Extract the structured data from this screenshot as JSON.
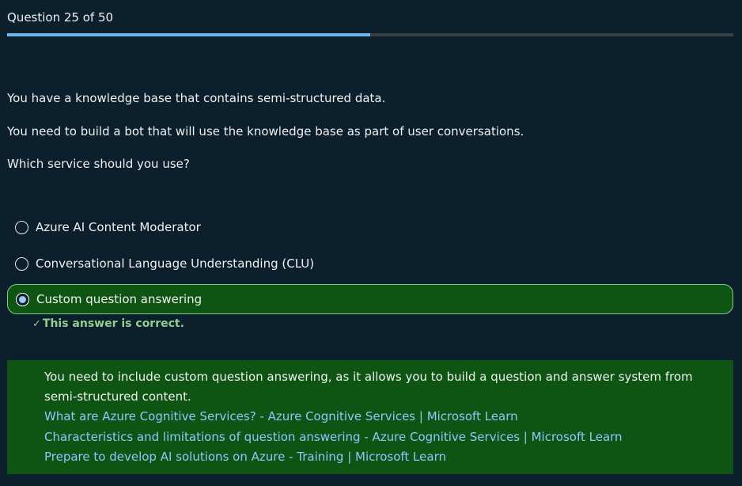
{
  "progress": {
    "label": "Question 25 of 50",
    "current": 25,
    "total": 50
  },
  "question": {
    "lines": [
      "You have a knowledge base that contains semi-structured data.",
      "You need to build a bot that will use the knowledge base as part of user conversations.",
      "Which service should you use?"
    ]
  },
  "options": [
    {
      "label": "Azure AI Content Moderator",
      "selected": false
    },
    {
      "label": "Conversational Language Understanding (CLU)",
      "selected": false
    },
    {
      "label": "Custom question answering",
      "selected": true
    }
  ],
  "feedback": {
    "check_glyph": "✓",
    "text": "This answer is correct."
  },
  "explanation": {
    "text": "You need to include custom question answering, as it allows you to build a question and answer system from semi-structured content.",
    "links": [
      "What are Azure Cognitive Services? - Azure Cognitive Services | Microsoft Learn",
      "Characteristics and limitations of question answering - Azure Cognitive Services | Microsoft Learn",
      "Prepare to develop AI solutions on Azure - Training | Microsoft Learn"
    ]
  },
  "colors": {
    "background": "#0c1f2c",
    "progress_fill": "#6cb6ef",
    "correct_bg": "#0e5514",
    "correct_border": "#7fcf85",
    "link": "#8cc8ff",
    "feedback_text": "#8fcf8f"
  },
  "icons": {
    "radio_unselected": "radio-unselected-icon",
    "radio_selected": "radio-selected-icon",
    "correct": "check-icon"
  }
}
